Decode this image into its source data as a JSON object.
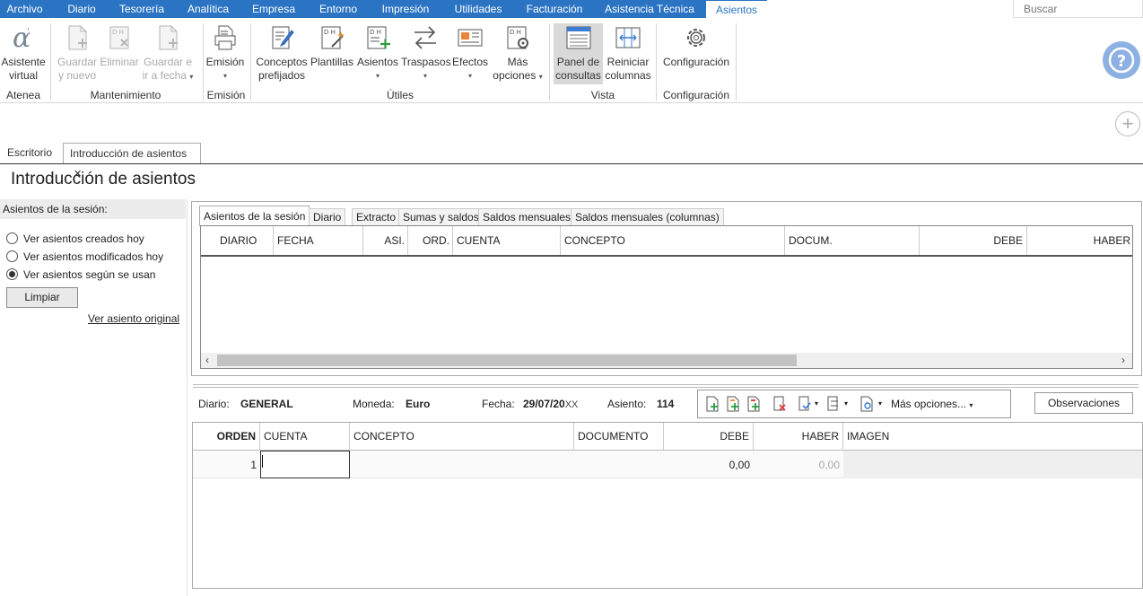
{
  "menu": {
    "items": [
      "Archivo",
      "Diario",
      "Tesorería",
      "Analítica",
      "Empresa",
      "Entorno",
      "Impresión",
      "Utilidades",
      "Facturación",
      "Asistencia Técnica",
      "Asientos"
    ],
    "active": "Asientos",
    "search_placeholder": "Buscar"
  },
  "ribbon": {
    "buttons": {
      "asistente": [
        "Asistente",
        "virtual"
      ],
      "guardar_nuevo": [
        "Guardar",
        "y nuevo"
      ],
      "eliminar": [
        "Eliminar"
      ],
      "guardar_fecha": [
        "Guardar e",
        "ir a fecha"
      ],
      "emision": [
        "Emisión"
      ],
      "conceptos": [
        "Conceptos",
        "prefijados"
      ],
      "plantillas": [
        "Plantillas"
      ],
      "asientos": [
        "Asientos"
      ],
      "traspasos": [
        "Traspasos"
      ],
      "efectos": [
        "Efectos"
      ],
      "mas_opciones": [
        "Más",
        "opciones"
      ],
      "panel": [
        "Panel de",
        "consultas"
      ],
      "reiniciar": [
        "Reiniciar",
        "columnas"
      ],
      "configuracion": [
        "Configuración"
      ]
    },
    "groups": {
      "atenea": "Atenea",
      "mantenimiento": "Mantenimiento",
      "emision": "Emisión",
      "utiles": "Útiles",
      "vista": "Vista",
      "configuracion": "Configuración"
    }
  },
  "doc_tabs": {
    "escritorio": "Escritorio",
    "intro": "Introducción de asientos",
    "close": "✕"
  },
  "page_title": "Introducción de asientos",
  "left_panel": {
    "header": "Asientos de la sesión:",
    "options": [
      "Ver asientos creados hoy",
      "Ver asientos modificados hoy",
      "Ver asientos según se usan"
    ],
    "selected": 2,
    "button": "Limpiar",
    "link": "Ver asiento original"
  },
  "upper_tabs": [
    "Asientos de la sesión",
    "Diario",
    "Extracto",
    "Sumas y saldos",
    "Saldos mensuales",
    "Saldos mensuales (columnas)"
  ],
  "upper_columns": [
    "DIARIO",
    "FECHA",
    "ASI.",
    "ORD.",
    "CUENTA",
    "CONCEPTO",
    "DOCUM.",
    "DEBE",
    "HABER"
  ],
  "info": {
    "diario_label": "Diario:",
    "diario_value": "GENERAL",
    "moneda_label": "Moneda:",
    "moneda_value": "Euro",
    "fecha_label": "Fecha:",
    "fecha_value": "29/07/20",
    "fecha_suffix": "XX",
    "asiento_label": "Asiento:",
    "asiento_value": "114",
    "mas_opciones": "Más opciones...",
    "observaciones": "Observaciones"
  },
  "lower_columns": [
    "ORDEN",
    "CUENTA",
    "CONCEPTO",
    "DOCUMENTO",
    "DEBE",
    "HABER",
    "IMAGEN"
  ],
  "lower_rows": [
    {
      "orden": "1",
      "cuenta": "",
      "concepto": "",
      "documento": "",
      "debe": "0,00",
      "haber": "0,00"
    }
  ]
}
